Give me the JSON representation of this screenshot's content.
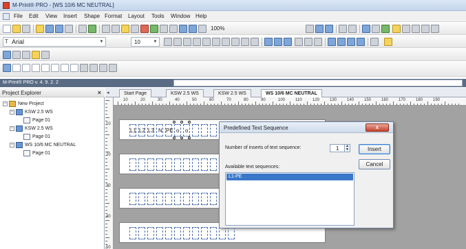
{
  "window": {
    "title": "M-Print® PRO - [WS 10/6 MC NEUTRAL]"
  },
  "menu": [
    "File",
    "Edit",
    "View",
    "Insert",
    "Shape",
    "Format",
    "Layout",
    "Tools",
    "Window",
    "Help"
  ],
  "toolbar": {
    "zoom": "100%"
  },
  "format_bar": {
    "font": "Arial",
    "font_size": "10"
  },
  "status": {
    "version": "M-Print® PRO v. 4. 9. 2. 2"
  },
  "explorer": {
    "title": "Project Explorer",
    "close_glyph": "×",
    "tree": [
      {
        "label": "New Project",
        "type": "project",
        "expander": "−"
      },
      {
        "label": "KSW 2.5 WS",
        "type": "ws",
        "expander": "−"
      },
      {
        "label": "Page 01",
        "type": "page",
        "expander": ""
      },
      {
        "label": "KSW 2.5 WS",
        "type": "ws",
        "expander": "−"
      },
      {
        "label": "Page 01",
        "type": "page",
        "expander": ""
      },
      {
        "label": "WS 10/6 MC NEUTRAL",
        "type": "ws",
        "expander": "−"
      },
      {
        "label": "Page 01",
        "type": "page",
        "expander": ""
      }
    ]
  },
  "tabs": {
    "nav": "◂",
    "items": [
      {
        "label": "Start Page",
        "active": false
      },
      {
        "label": "KSW 2.5 WS",
        "active": false
      },
      {
        "label": "KSW 2.5 WS",
        "active": false
      },
      {
        "label": "WS 10/6 MC NEUTRAL",
        "active": true
      }
    ]
  },
  "ruler": {
    "h_labels": [
      "10",
      "20",
      "30",
      "40",
      "50",
      "60",
      "70",
      "80",
      "90",
      "100",
      "110",
      "120",
      "130",
      "140",
      "150",
      "160",
      "170",
      "180",
      "190"
    ],
    "v_labels": [
      "10",
      "20",
      "30",
      "40",
      "50"
    ]
  },
  "label_cells": [
    "L1",
    "L2",
    "L3",
    "N",
    "PE",
    "o",
    "o"
  ],
  "dialog": {
    "title": "Predefined Text Sequence",
    "close_glyph": "x",
    "inserts_label": "Number of inserts of text sequence:",
    "inserts_value": "1",
    "available_label": "Available text sequences:",
    "sequences": [
      "L1-PE"
    ],
    "insert_button": "Insert",
    "cancel_button": "Cancel"
  }
}
